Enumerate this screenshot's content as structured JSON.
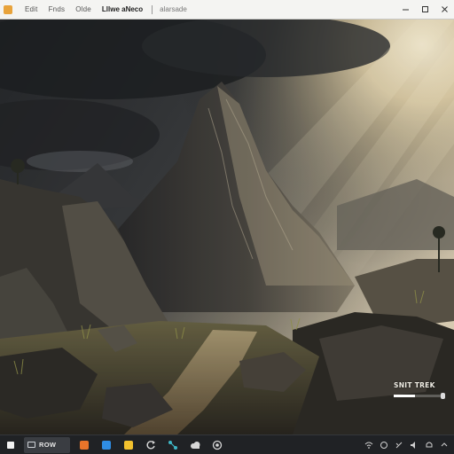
{
  "menubar": {
    "items": [
      "Edit",
      "Fnds",
      "Olde"
    ],
    "title": "Lllwe aNeco",
    "subtitle": "alarsade",
    "controls": [
      "minimize-icon",
      "maximize-icon",
      "close-icon"
    ]
  },
  "overlay": {
    "title": "SNIT TREK",
    "progress": 0.42
  },
  "taskbar": {
    "active_label": "ROW",
    "apps": [
      {
        "name": "orange-app-icon",
        "color": "#e8742a"
      },
      {
        "name": "blue-app-icon",
        "color": "#2f8de4"
      },
      {
        "name": "yellow-app-icon",
        "color": "#f2c12e"
      },
      {
        "name": "refresh-app-icon",
        "color": "#cfcfcf"
      },
      {
        "name": "network-app-icon",
        "color": "#3fb7c6"
      },
      {
        "name": "cloud-app-icon",
        "color": "#d8d8d8"
      },
      {
        "name": "globe-app-icon",
        "color": "#d8d8d8"
      }
    ],
    "tray": [
      "tray-wifi-icon",
      "tray-circle-icon",
      "tray-link-icon",
      "tray-sound-icon",
      "tray-bell-icon",
      "tray-expand-icon"
    ]
  },
  "colors": {
    "menubar_bg": "#f4f4f2",
    "taskbar_bg": "#202225",
    "accent": "#e8a33b"
  }
}
